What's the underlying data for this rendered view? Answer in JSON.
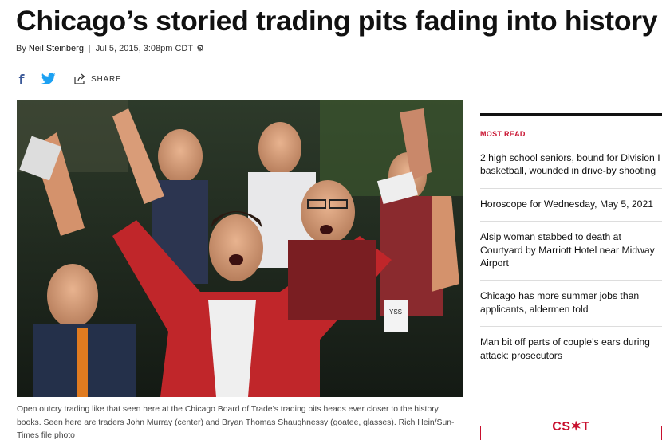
{
  "article": {
    "headline": "Chicago’s storied trading pits fading into history",
    "byline_prefix": "By",
    "author": "Neil Steinberg",
    "separator": "|",
    "date": "Jul 5, 2015, 3:08pm CDT",
    "share_label": "SHARE",
    "caption": "Open outcry trading like that seen here at the Chicago Board of Trade’s trading pits heads ever closer to the history books. Seen here are traders John Murray (center) and Bryan Thomas Shaughnessy (goatee, glasses). Rich Hein/Sun-Times file photo"
  },
  "icons": {
    "settings": "gear-icon",
    "facebook": "facebook-icon",
    "twitter": "twitter-icon",
    "share": "share-icon"
  },
  "sidebar": {
    "section_title": "MOST READ",
    "items": [
      {
        "label": "2 high school seniors, bound for Division I basketball, wounded in drive-by shooting"
      },
      {
        "label": "Horoscope for Wednesday, May 5, 2021"
      },
      {
        "label": "Alsip woman stabbed to death at Courtyard by Marriott Hotel near Midway Airport"
      },
      {
        "label": "Chicago has more summer jobs than applicants, aldermen told"
      },
      {
        "label": "Man bit off parts of couple’s ears during attack: prosecutors"
      }
    ],
    "logo_text": "CS✶T"
  },
  "colors": {
    "brand_red": "#c8102e",
    "facebook_blue": "#3b5998",
    "twitter_blue": "#1da1f2"
  }
}
